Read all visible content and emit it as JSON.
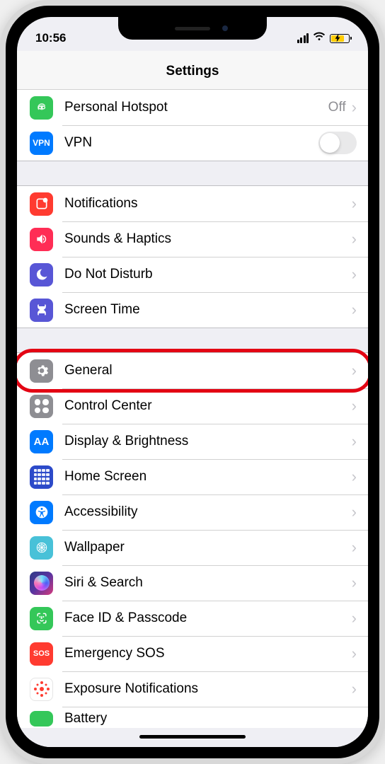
{
  "status": {
    "time": "10:56"
  },
  "header": {
    "title": "Settings"
  },
  "sections": [
    {
      "rows": [
        {
          "id": "personal-hotspot",
          "label": "Personal Hotspot",
          "value": "Off",
          "accessory": "disclosure"
        },
        {
          "id": "vpn",
          "label": "VPN",
          "accessory": "toggle",
          "toggle_on": false
        }
      ]
    },
    {
      "rows": [
        {
          "id": "notifications",
          "label": "Notifications",
          "accessory": "disclosure"
        },
        {
          "id": "sounds-haptics",
          "label": "Sounds & Haptics",
          "accessory": "disclosure"
        },
        {
          "id": "do-not-disturb",
          "label": "Do Not Disturb",
          "accessory": "disclosure"
        },
        {
          "id": "screen-time",
          "label": "Screen Time",
          "accessory": "disclosure"
        }
      ]
    },
    {
      "rows": [
        {
          "id": "general",
          "label": "General",
          "accessory": "disclosure",
          "highlighted": true
        },
        {
          "id": "control-center",
          "label": "Control Center",
          "accessory": "disclosure"
        },
        {
          "id": "display-brightness",
          "label": "Display & Brightness",
          "accessory": "disclosure"
        },
        {
          "id": "home-screen",
          "label": "Home Screen",
          "accessory": "disclosure"
        },
        {
          "id": "accessibility",
          "label": "Accessibility",
          "accessory": "disclosure"
        },
        {
          "id": "wallpaper",
          "label": "Wallpaper",
          "accessory": "disclosure"
        },
        {
          "id": "siri-search",
          "label": "Siri & Search",
          "accessory": "disclosure"
        },
        {
          "id": "face-id-passcode",
          "label": "Face ID & Passcode",
          "accessory": "disclosure"
        },
        {
          "id": "emergency-sos",
          "label": "Emergency SOS",
          "accessory": "disclosure"
        },
        {
          "id": "exposure-notifications",
          "label": "Exposure Notifications",
          "accessory": "disclosure"
        },
        {
          "id": "battery",
          "label": "Battery",
          "accessory": "disclosure"
        }
      ]
    }
  ],
  "icons": {
    "vpn_text": "VPN",
    "display_text": "AA",
    "sos_text": "SOS"
  }
}
